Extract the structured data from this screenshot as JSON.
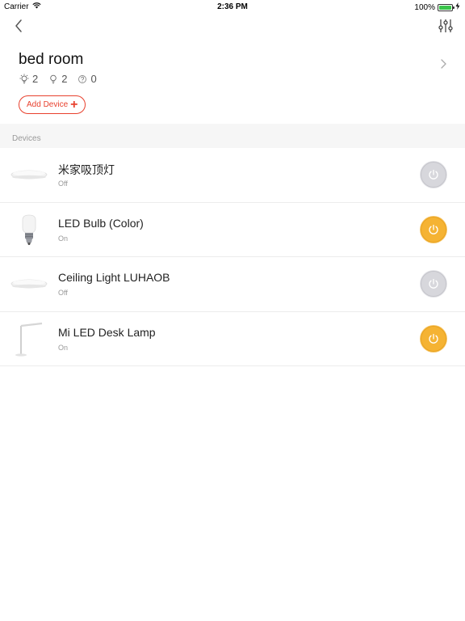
{
  "status_bar": {
    "carrier": "Carrier",
    "time": "2:36 PM",
    "battery": "100%"
  },
  "navbar": {
    "back_icon": "chevron-left-icon",
    "settings_icon": "sliders-icon"
  },
  "room": {
    "title": "bed room",
    "lights_on_count": "2",
    "lights_count": "2",
    "unknown_count": "0",
    "add_device_label": "Add Device"
  },
  "section": {
    "devices_label": "Devices"
  },
  "devices": [
    {
      "name": "米家吸顶灯",
      "status": "Off",
      "power": "off",
      "icon": "ceiling-light-icon"
    },
    {
      "name": "LED Bulb (Color)",
      "status": "On",
      "power": "on",
      "icon": "bulb-icon"
    },
    {
      "name": "Ceiling Light LUHAOB",
      "status": "Off",
      "power": "off",
      "icon": "ceiling-light-icon"
    },
    {
      "name": "Mi LED Desk Lamp",
      "status": "On",
      "power": "on",
      "icon": "desk-lamp-icon"
    }
  ],
  "colors": {
    "accent_red": "#e8412e",
    "power_on": "#f5b333",
    "power_off": "#d7d7dc"
  }
}
